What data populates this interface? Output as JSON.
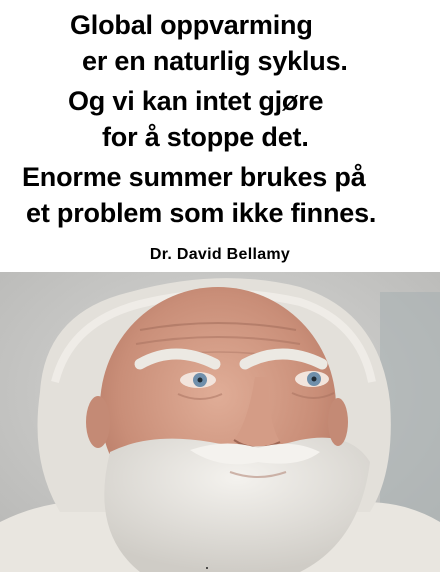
{
  "quote": {
    "lines": [
      "Global oppvarming",
      "er en naturlig syklus.",
      "Og vi kan intet gjøre",
      "for å stoppe det.",
      "Enorme summer brukes på",
      "et problem som ikke finnes."
    ],
    "attribution": "Dr. David Bellamy"
  },
  "image": {
    "subject": "portrait-of-elderly-man-with-white-beard",
    "background_color": "#c9c9c7",
    "hair_color": "#e8e6e1",
    "skin_color": "#d19a84",
    "eye_color": "#6f8fab"
  }
}
